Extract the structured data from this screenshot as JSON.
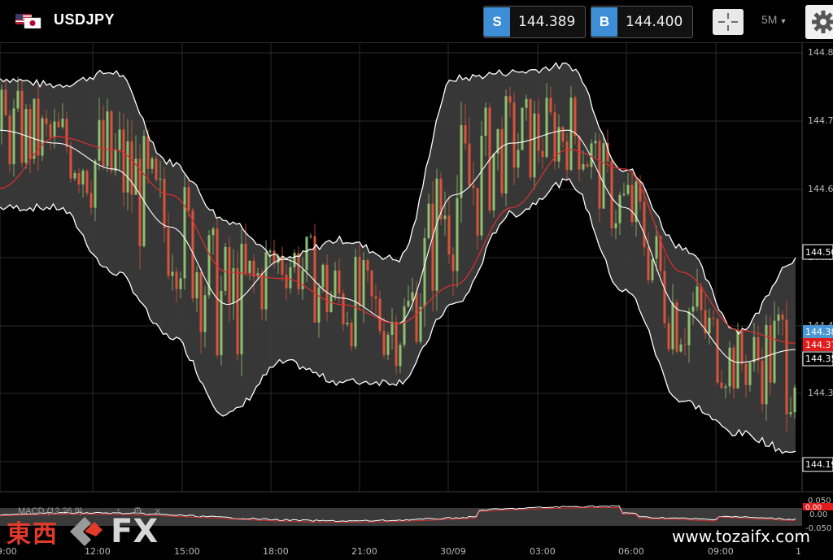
{
  "header": {
    "symbol": "USDJPY",
    "sell": {
      "tag": "S",
      "price": "144.389"
    },
    "buy": {
      "tag": "B",
      "price": "144.400"
    },
    "timeframe": "5M"
  },
  "colors": {
    "background": "#000000",
    "band_fill": "#3a3a3a",
    "up_candle": "#8fbf6e",
    "down_candle": "#d9533b",
    "ma_line": "#d62f2f",
    "band_line": "#ffffff",
    "sell_tag": "#3d8ed6",
    "current_red": "#e21b1b",
    "current_blue": "#4a97d6"
  },
  "icons": {
    "flags": "us-jp-flag-icon",
    "crosshair": "crosshair-icon",
    "settings": "gear-icon",
    "dropdown": "caret-down-icon"
  },
  "price_axis": {
    "labels": [
      "144.8",
      "144.7",
      "144.6",
      "144.5",
      "144.4",
      "144.3"
    ],
    "markers": [
      {
        "text": "144.50",
        "style": "box"
      },
      {
        "text": "144.38",
        "style": "blue"
      },
      {
        "text": "144.37",
        "style": "red"
      },
      {
        "text": "144.35",
        "style": "box"
      },
      {
        "text": "144.19",
        "style": "box"
      }
    ]
  },
  "time_axis": {
    "labels": [
      "9:00",
      "12:00",
      "15:00",
      "18:00",
      "21:00",
      "30/09",
      "03:00",
      "06:00",
      "09:00",
      "1"
    ]
  },
  "macd": {
    "label": "MACD (12,26,9)",
    "axis": [
      "0.050",
      "0.00",
      "-0.050"
    ],
    "markers": [
      "0.00",
      "0.00"
    ],
    "controls": [
      "↑",
      "gear",
      "×"
    ]
  },
  "watermark": {
    "kanji": "東西",
    "fx": "FX",
    "url": "www.tozaifx.com"
  },
  "chart_data": {
    "type": "candlestick",
    "title": "USDJPY",
    "timeframe": "5M",
    "ylim": [
      144.18,
      144.82
    ],
    "x": [
      "9:00",
      "12:00",
      "15:00",
      "18:00",
      "21:00",
      "30/09",
      "03:00",
      "06:00",
      "09:00"
    ],
    "series": [
      {
        "name": "Bollinger upper",
        "values": [
          144.78,
          144.77,
          144.79,
          144.65,
          144.56,
          144.5,
          144.53,
          144.5,
          144.78,
          144.79,
          144.8,
          144.64,
          144.52,
          144.39,
          144.5
        ]
      },
      {
        "name": "Bollinger middle",
        "values": [
          144.7,
          144.68,
          144.64,
          144.55,
          144.43,
          144.5,
          144.44,
          144.4,
          144.6,
          144.68,
          144.7,
          144.58,
          144.42,
          144.34,
          144.36
        ]
      },
      {
        "name": "Bollinger lower",
        "values": [
          144.58,
          144.58,
          144.48,
          144.38,
          144.26,
          144.34,
          144.31,
          144.31,
          144.43,
          144.57,
          144.62,
          144.45,
          144.28,
          144.23,
          144.2
        ]
      },
      {
        "name": "Moving average",
        "values": [
          144.61,
          144.69,
          144.67,
          144.6,
          144.48,
          144.47,
          144.43,
          144.4,
          144.46,
          144.58,
          144.67,
          144.64,
          144.48,
          144.39,
          144.37
        ]
      }
    ],
    "bid_price": 144.389,
    "ask_price": 144.4
  }
}
